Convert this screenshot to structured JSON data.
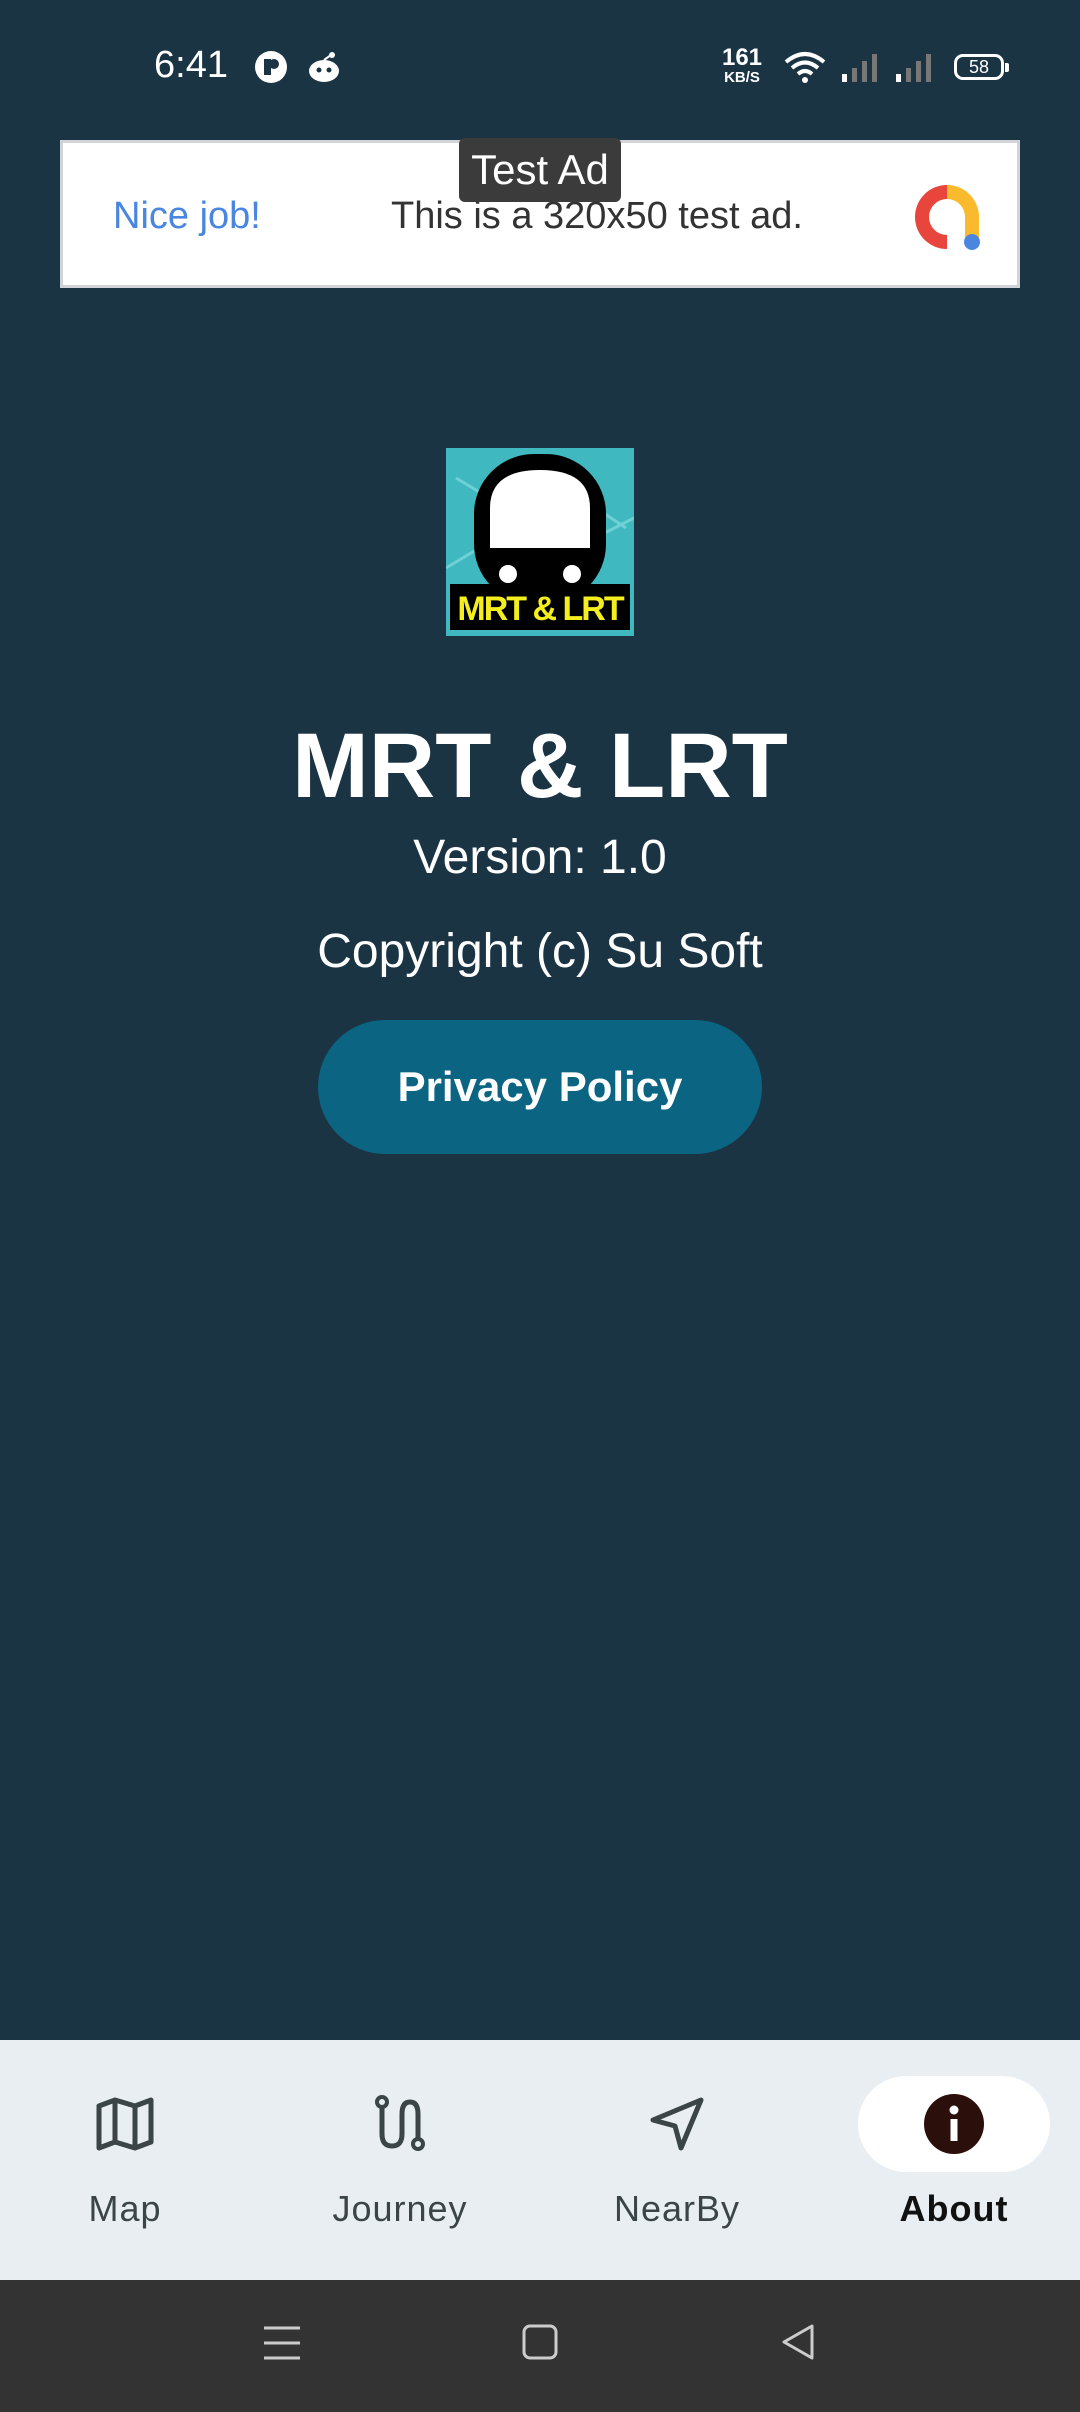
{
  "status_bar": {
    "time": "6:41",
    "net_speed_value": "161",
    "net_speed_unit": "KB/S",
    "battery": "58"
  },
  "ad": {
    "tag": "Test Ad",
    "headline": "Nice job!",
    "text": "This is a 320x50 test ad."
  },
  "app": {
    "logo_text": "MRT & LRT",
    "title": "MRT & LRT",
    "version": "Version: 1.0",
    "copyright": "Copyright (c) Su Soft",
    "privacy_button": "Privacy Policy"
  },
  "bottom_nav": {
    "items": [
      {
        "label": "Map",
        "icon": "map-icon"
      },
      {
        "label": "Journey",
        "icon": "route-icon"
      },
      {
        "label": "NearBy",
        "icon": "navigation-arrow-icon"
      },
      {
        "label": "About",
        "icon": "info-icon"
      }
    ],
    "active": "About"
  },
  "colors": {
    "background": "#1a3444",
    "button": "#0a6482",
    "nav_background": "#e8eef1",
    "ad_headline": "#4a86e0"
  }
}
